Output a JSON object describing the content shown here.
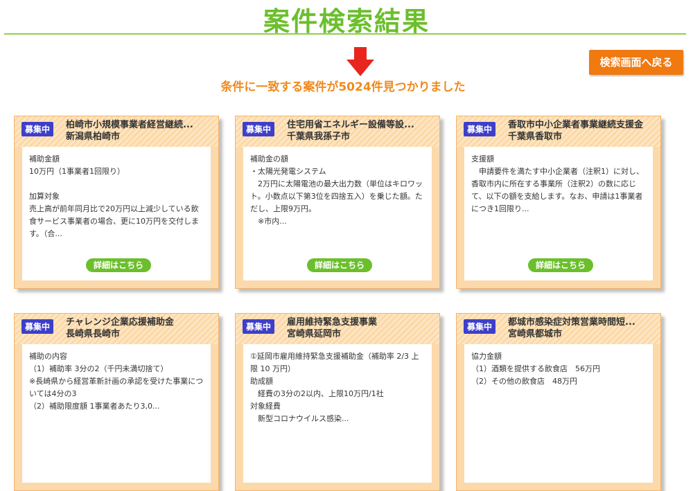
{
  "header": {
    "title": "案件検索結果",
    "result_text": "条件に一致する案件が5024件見つかりました",
    "back_button": "検索画面へ戻る"
  },
  "cards": [
    {
      "badge": "募集中",
      "title": "柏崎市小規模事業者経営継続...",
      "location": "新潟県柏崎市",
      "body": "補助金額\n10万円（1事業者1回限り）\n\n加算対象\n売上高が前年同月比で20万円以上減少している飲食サービス事業者の場合、更に10万円を交付します。（合...",
      "detail": "詳細はこちら"
    },
    {
      "badge": "募集中",
      "title": "住宅用省エネルギー設備等設...",
      "location": "千葉県我孫子市",
      "body": "補助金の額\n・太陽光発電システム\n　2万円に太陽電池の最大出力数（単位はキロワット。小数点以下第3位を四捨五入）を乗じた額。ただし、上限9万円。\n　※市内...",
      "detail": "詳細はこちら"
    },
    {
      "badge": "募集中",
      "title": "香取市中小企業者事業継続支援金",
      "location": "千葉県香取市",
      "body": "支援額\n　申請要件を満たす中小企業者（注釈1）に対し、香取市内に所在する事業所（注釈2）の数に応じて、以下の額を支給します。なお、申請は1事業者につき1回限り...",
      "detail": "詳細はこちら"
    },
    {
      "badge": "募集中",
      "title": "チャレンジ企業応援補助金",
      "location": "長崎県長崎市",
      "body": "補助の内容\n（1）補助率 3分の2（千円未満切捨て）\n※長崎県から経営革新計画の承認を受けた事業については4分の3\n（2）補助限度額 1事業者あたり3,0...",
      "detail": ""
    },
    {
      "badge": "募集中",
      "title": "雇用維持緊急支援事業",
      "location": "宮崎県延岡市",
      "body": "①延岡市雇用維持緊急支援補助金（補助率 2/3 上限 10 万円）\n助成額\n　経費の3分の2以内、上限10万円/1社\n対象経費\n　新型コロナウイルス感染...",
      "detail": ""
    },
    {
      "badge": "募集中",
      "title": "都城市感染症対策営業時間短...",
      "location": "宮崎県都城市",
      "body": "協力金額\n（1）酒類を提供する飲食店　56万円\n（2）その他の飲食店　48万円",
      "detail": ""
    }
  ]
}
